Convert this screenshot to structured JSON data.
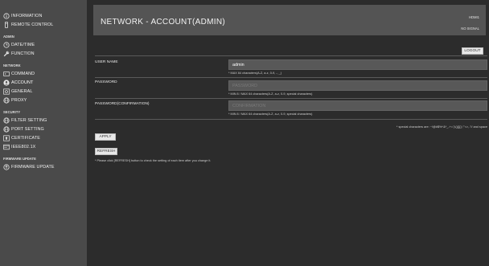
{
  "sidebar": {
    "top_items": [
      {
        "label": "INFORMATION",
        "icon": "info-icon"
      },
      {
        "label": "REMOTE CONTROL",
        "icon": "remote-icon"
      }
    ],
    "sections": [
      {
        "title": "ADMIN",
        "items": [
          {
            "label": "DATE/TIME",
            "icon": "clock-icon"
          },
          {
            "label": "FUNCTION",
            "icon": "wrench-icon"
          }
        ]
      },
      {
        "title": "NETWORK",
        "items": [
          {
            "label": "COMMAND",
            "icon": "command-icon"
          },
          {
            "label": "ACCOUNT",
            "icon": "user-icon"
          },
          {
            "label": "GENERAL",
            "icon": "gear-icon"
          },
          {
            "label": "PROXY",
            "icon": "globe-icon"
          }
        ]
      },
      {
        "title": "SECURITY",
        "items": [
          {
            "label": "FILTER SETTING",
            "icon": "globe-icon"
          },
          {
            "label": "PORT SETTING",
            "icon": "globe-icon"
          },
          {
            "label": "CERTIFICATE",
            "icon": "certificate-icon"
          },
          {
            "label": "IEEE802.1X",
            "icon": "network-icon"
          }
        ]
      },
      {
        "title": "FIRMWARE UPDATE",
        "items": [
          {
            "label": "FIRMWARE UPDATE",
            "icon": "upload-icon"
          }
        ]
      }
    ]
  },
  "header": {
    "title": "NETWORK - ACCOUNT(ADMIN)",
    "input": "HDMI1",
    "signal": "NO SIGNAL"
  },
  "logout_label": "LOGOUT",
  "form": {
    "username_label": "USER NAME",
    "username_value": "admin",
    "username_hint": "* MAX 64 characters(A-Z, a-z, 0-9, -, _)",
    "password_label": "PASSWORD",
    "password_placeholder": "PASSWORD",
    "password_hint": "* MIN 8 / MAX 64 characters(A-Z, a-z, 0-9, special characters)",
    "confirm_label": "PASSWORD(CONFIRMATION)",
    "confirm_placeholder": "CONFIRMATION",
    "confirm_hint": "* MIN 8 / MAX 64 characters(A-Z, a-z, 0-9, special characters)",
    "special_note": "* special characters are: ~!@#$%^&*_-+=`|\\(){}[]:;\"'<>,.?/ and space"
  },
  "apply_label": "APPLY",
  "refresh_label": "REFRESH",
  "refresh_note": "* Please click [REFRESH] button to check the setting of each item after you change it."
}
